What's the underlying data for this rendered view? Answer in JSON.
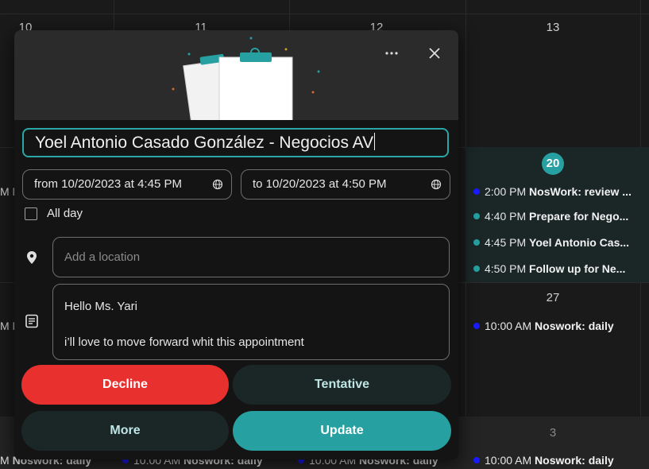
{
  "calendar": {
    "day_numbers": [
      "10",
      "11",
      "12",
      "13",
      "20",
      "27",
      "3"
    ],
    "events_today": [
      {
        "time": "2:00 PM",
        "title": "NosWork: review ...",
        "color": "#1a1aff"
      },
      {
        "time": "4:40 PM",
        "title": "Prepare for Nego...",
        "color": "#26a0a0"
      },
      {
        "time": "4:45 PM",
        "title": "Yoel Antonio Cas...",
        "color": "#26a0a0"
      },
      {
        "time": "4:50 PM",
        "title": "Follow up for Ne...",
        "color": "#26a0a0"
      }
    ],
    "event_27": {
      "time": "10:00 AM",
      "title": "Noswork: daily",
      "color": "#1a1aff"
    },
    "bottom_events": [
      {
        "time": "M",
        "title": "Noswork: daily"
      },
      {
        "time": "10:00 AM",
        "title": "Noswork: daily"
      },
      {
        "time": "10:00 AM",
        "title": "Noswork: daily"
      },
      {
        "time": "10:00 AM",
        "title": "Noswork: daily"
      }
    ],
    "left_clip_text": [
      "M N",
      "M N"
    ]
  },
  "dialog": {
    "more_options_icon": "ellipsis-icon",
    "close_icon": "close-icon",
    "title_value": "Yoel Antonio Casado González - Negocios AV",
    "from_label": "from 10/20/2023 at 4:45 PM",
    "to_label": "to 10/20/2023 at 4:50 PM",
    "all_day_label": "All day",
    "location_placeholder": "Add a location",
    "notes_line1": "Hello Ms. Yari",
    "notes_line2": "i’ll love to move forward whit this appointment",
    "buttons": {
      "decline": "Decline",
      "tentative": "Tentative",
      "more": "More",
      "update": "Update"
    },
    "colors": {
      "accent": "#26a0a0",
      "decline": "#e8302e",
      "dark_button": "#1b2626"
    }
  }
}
